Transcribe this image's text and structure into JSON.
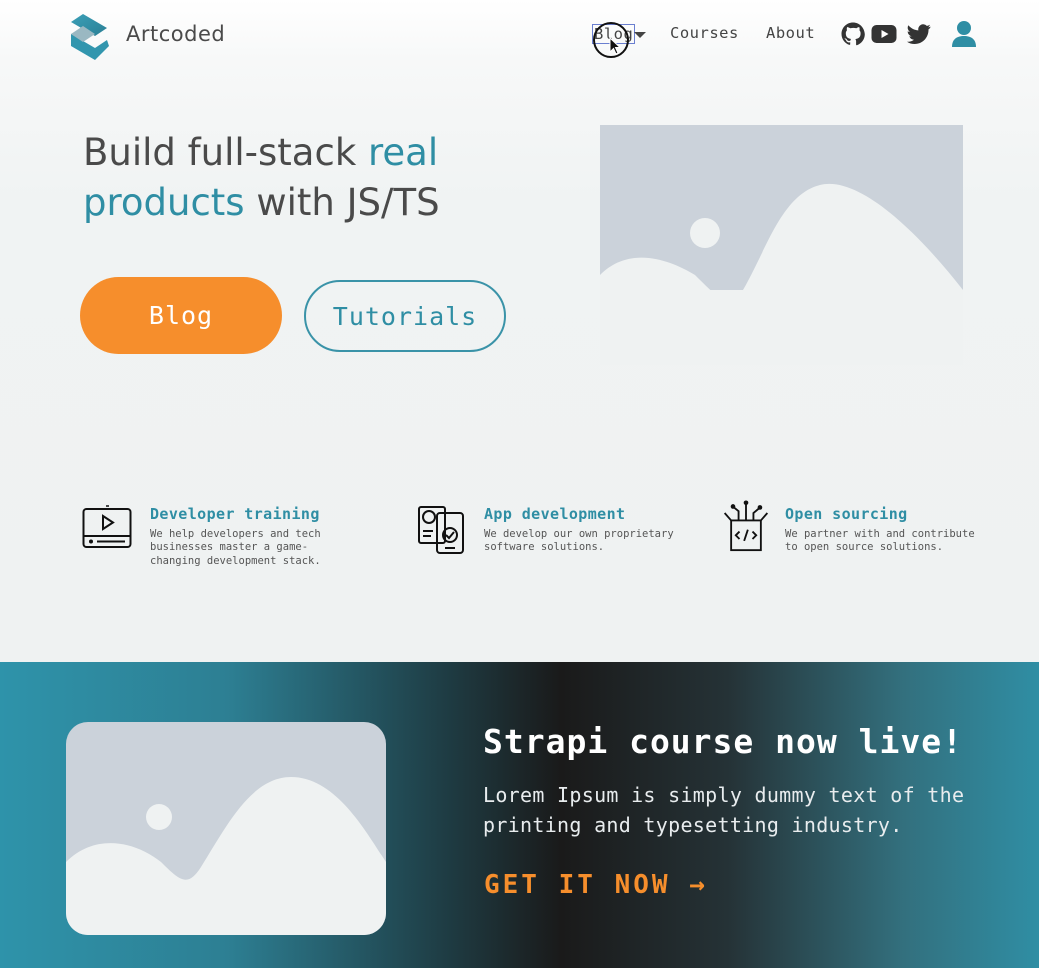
{
  "header": {
    "brand": "Artcoded",
    "nav": {
      "blog": "Blog",
      "courses": "Courses",
      "about": "About"
    },
    "social": [
      "github-icon",
      "youtube-icon",
      "twitter-icon"
    ],
    "user_icon": "user-icon"
  },
  "hero": {
    "title_part1": "Build full-stack ",
    "title_highlight": "real products",
    "title_part2": " with JS/TS",
    "blog_button": "Blog",
    "tutorials_button": "Tutorials"
  },
  "features": [
    {
      "icon": "video-player-icon",
      "title": "Developer training",
      "desc": "We help developers and tech businesses master a game-changing development stack."
    },
    {
      "icon": "app-devices-icon",
      "title": "App development",
      "desc": "We develop our own proprietary software solutions."
    },
    {
      "icon": "open-source-box-icon",
      "title": "Open sourcing",
      "desc": "We partner with and contribute to open source solutions."
    }
  ],
  "banner": {
    "title": "Strapi course now live!",
    "text": "Lorem Ipsum is simply dummy text of the printing and typesetting industry.",
    "cta": "GET IT NOW →"
  },
  "colors": {
    "accent": "#2f8ea4",
    "orange": "#f68e2c",
    "placeholder": "#cbd2da"
  }
}
